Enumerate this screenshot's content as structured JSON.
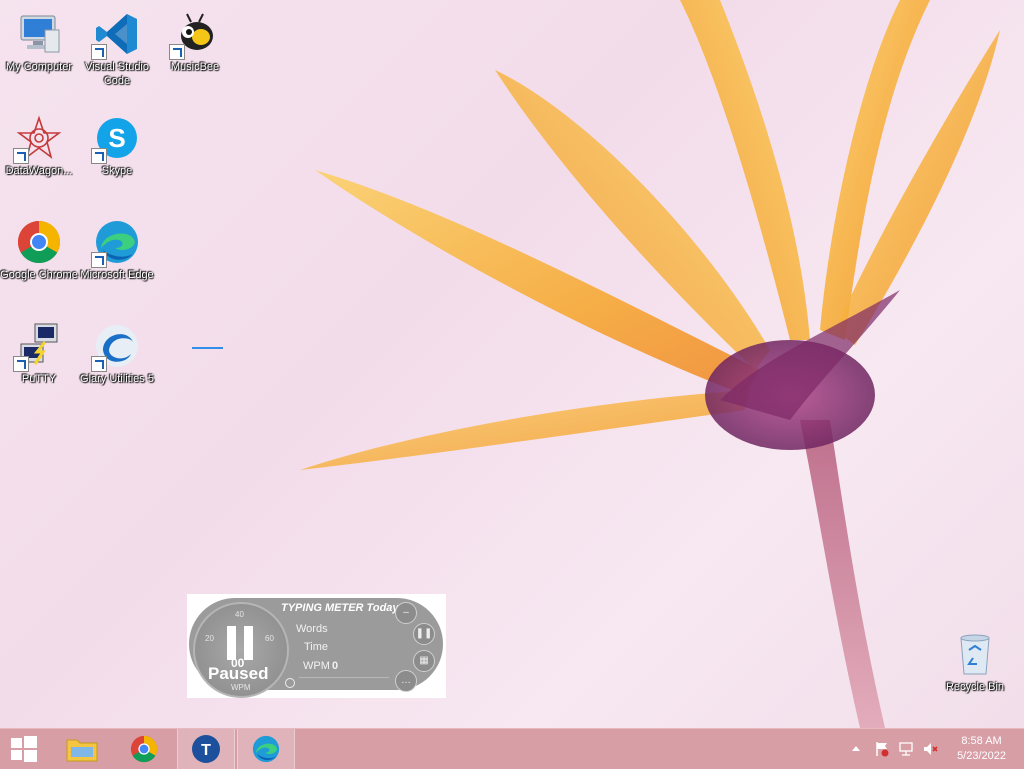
{
  "desktop": {
    "icons": [
      {
        "label": "My Computer",
        "icon": "computer-icon"
      },
      {
        "label": "Visual Studio Code",
        "icon": "vscode-icon"
      },
      {
        "label": "MusicBee",
        "icon": "musicbee-icon"
      },
      {
        "label": "DataWagon...",
        "icon": "datawagon-icon"
      },
      {
        "label": "Skype",
        "icon": "skype-icon"
      },
      {
        "label": "Google Chrome",
        "icon": "chrome-icon"
      },
      {
        "label": "Microsoft Edge",
        "icon": "edge-icon"
      },
      {
        "label": "PuTTY",
        "icon": "putty-icon"
      },
      {
        "label": "Glary Utilities 5",
        "icon": "glary-icon"
      },
      {
        "label": "Recycle Bin",
        "icon": "recycle-bin-icon"
      }
    ]
  },
  "typing_meter": {
    "title": "TYPING METER Today",
    "status": "Paused",
    "gauge_value": "00",
    "gauge_unit": "WPM",
    "ticks": [
      "20",
      "40",
      "60"
    ],
    "rows": [
      {
        "label": "Words",
        "value": ""
      },
      {
        "label": "Time",
        "value": ""
      },
      {
        "label": "WPM",
        "value": "0"
      }
    ]
  },
  "taskbar": {
    "buttons": [
      {
        "name": "start-button",
        "icon": "windows-logo-icon"
      },
      {
        "name": "file-explorer",
        "icon": "folder-icon"
      },
      {
        "name": "chrome",
        "icon": "chrome-icon"
      },
      {
        "name": "typing-meter",
        "icon": "typing-meter-icon"
      },
      {
        "name": "edge",
        "icon": "edge-icon"
      }
    ],
    "clock": {
      "time": "8:58 AM",
      "date": "5/23/2022"
    }
  },
  "colors": {
    "taskbar": "#d79ea6",
    "petal": "#f6a935",
    "flower_center": "#8a2f6a"
  }
}
